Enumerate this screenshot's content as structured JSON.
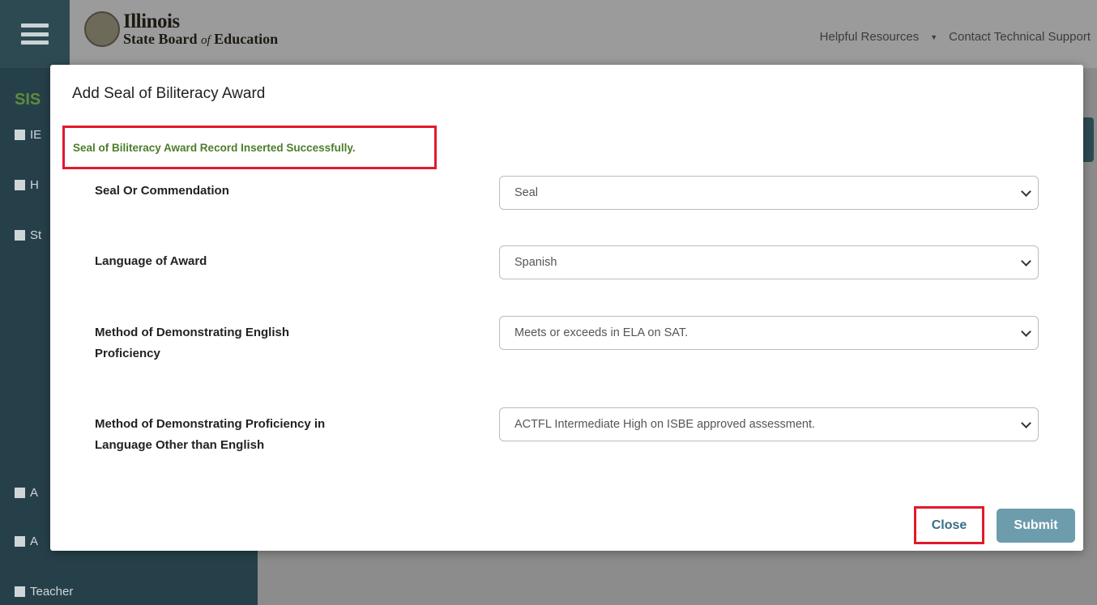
{
  "header": {
    "logo_line1": "Illinois",
    "logo_line2_a": "State Board",
    "logo_line2_of": "of",
    "logo_line2_b": "Education",
    "helpful_resources": "Helpful Resources",
    "contact_support": "Contact Technical Support"
  },
  "sidebar": {
    "app_label": "SIS",
    "items": [
      {
        "label": "IE"
      },
      {
        "label": "H"
      },
      {
        "label": "St"
      },
      {
        "label": "A"
      },
      {
        "label": "A"
      },
      {
        "label": "Teacher"
      }
    ]
  },
  "modal": {
    "title": "Add Seal of Biliteracy Award",
    "success_message": "Seal of Biliteracy Award Record Inserted Successfully.",
    "fields": [
      {
        "label": "Seal Or Commendation",
        "value": "Seal"
      },
      {
        "label": "Language of Award",
        "value": "Spanish"
      },
      {
        "label": "Method of Demonstrating English Proficiency",
        "value": "Meets or exceeds in ELA on SAT."
      },
      {
        "label": "Method of Demonstrating Proficiency in Language Other than English",
        "value": "ACTFL Intermediate High on ISBE approved assessment."
      }
    ],
    "close_label": "Close",
    "submit_label": "Submit"
  },
  "colors": {
    "success_text": "#4d7d2b",
    "highlight_border": "#e2192c",
    "submit_bg": "#6d9cad",
    "sidebar_bg": "#26404a"
  }
}
